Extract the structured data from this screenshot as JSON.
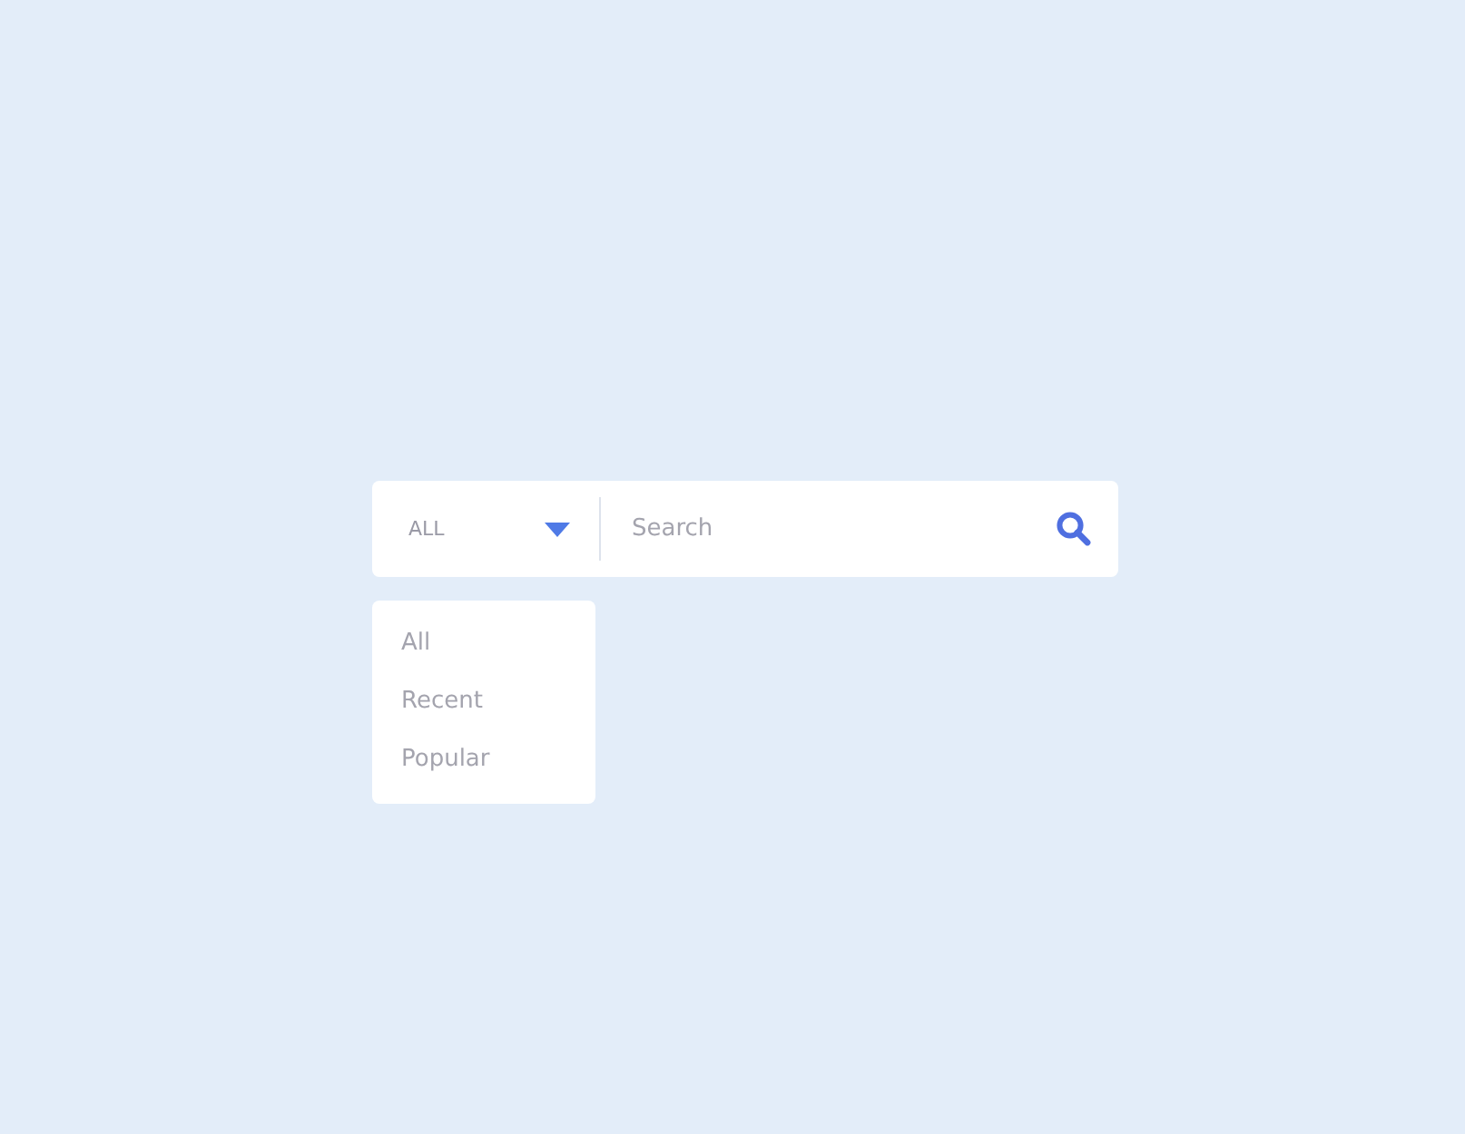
{
  "search_bar": {
    "category": "ALL",
    "placeholder": "Search"
  },
  "dropdown": {
    "items": [
      {
        "label": "All"
      },
      {
        "label": "Recent"
      },
      {
        "label": "Popular"
      }
    ]
  }
}
